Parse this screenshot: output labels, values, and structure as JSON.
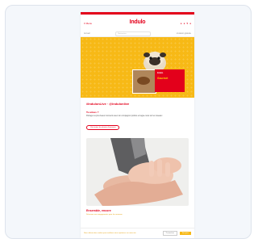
{
  "header": {
    "logo_text": "Indulo",
    "menu_label": "≡ Menu",
    "icons": [
      "search-icon",
      "user-icon",
      "heart-icon",
      "cart-icon"
    ]
  },
  "subbar": {
    "left_text": "Accueil",
    "search_placeholder": "Rechercher",
    "right_text": "Livraison gratuite"
  },
  "hero": {
    "promo_line1": "Indulo",
    "promo_line2": "Gourmet"
  },
  "section1": {
    "hashtag": "#IndulonLive · @indulonlive",
    "question": "Tu aimes ?",
    "description": "Partage tes plus beaux moments avec ton compagnon préféré et tague-nous sur les réseaux",
    "cta_label": "Voir toutes les photos d'animaux"
  },
  "section2": {
    "title": "Ensemble, encore",
    "subtitle": "Découvre nos engagements pour les animaux"
  },
  "cookie": {
    "text": "Nous utilisons des cookies pour améliorer votre expérience sur notre site.",
    "settings_label": "Paramètres",
    "accept_label": "Accepter"
  },
  "colors": {
    "brand_red": "#e3001b",
    "hero_yellow": "#f7b916",
    "accent_orange": "#e39c00"
  }
}
